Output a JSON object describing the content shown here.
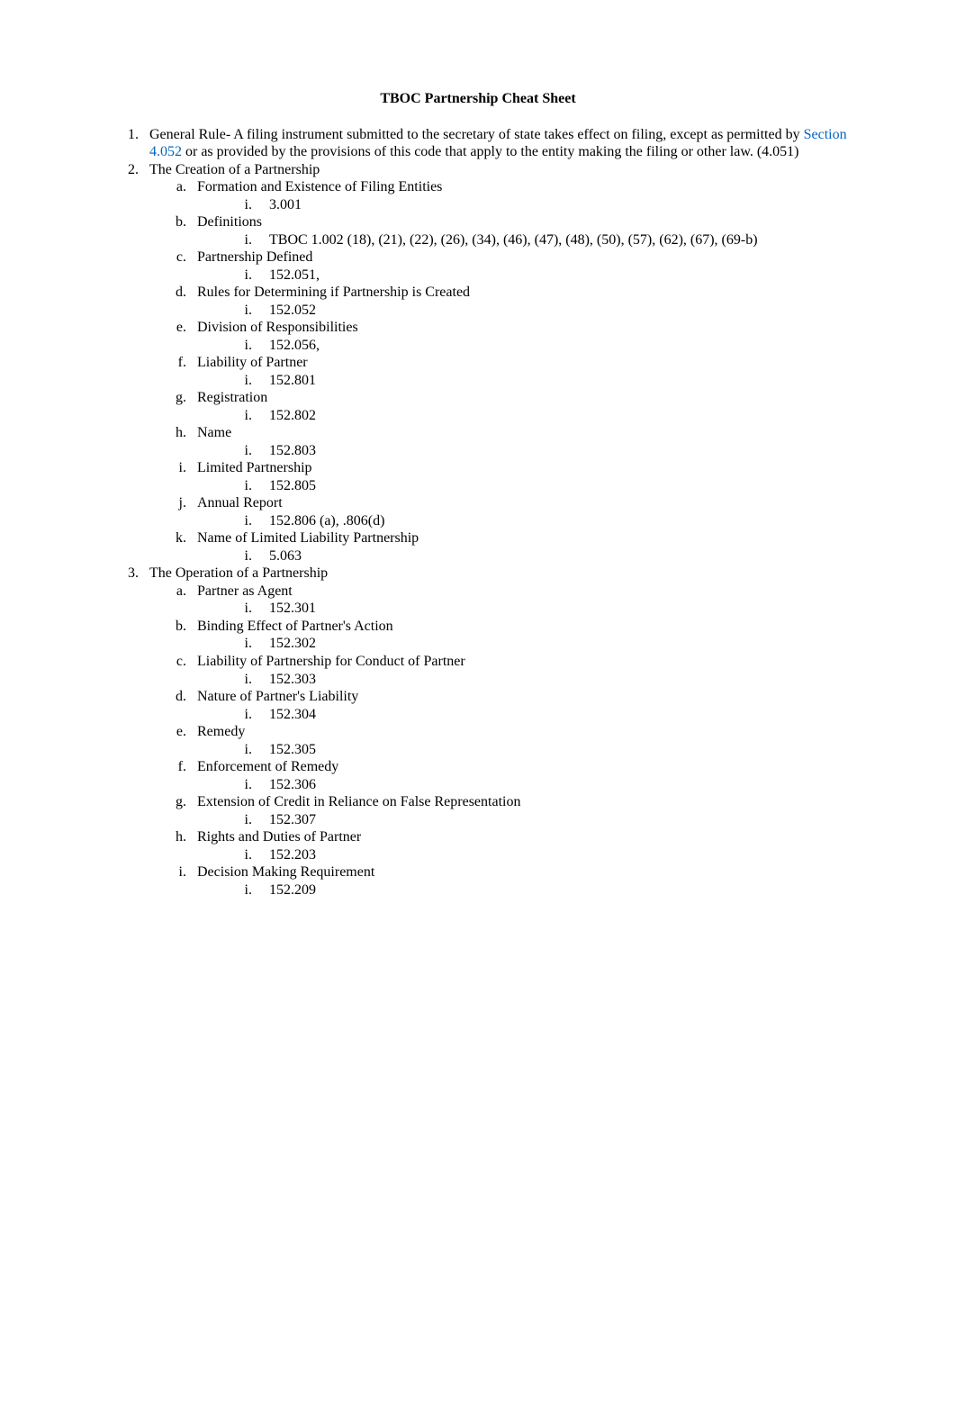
{
  "title": "TBOC Partnership Cheat Sheet",
  "items": {
    "1": {
      "pre": "General Rule- A filing instrument submitted to the secretary of state takes effect on filing, except as permitted by ",
      "link": "Section 4.052",
      "post": " or as provided by the provisions of this code that apply to the entity making the filing or other law. (4.051)"
    },
    "2": {
      "label": "The Creation of a Partnership",
      "a": {
        "label": "Formation and Existence of Filing Entities",
        "i": "3.001"
      },
      "b": {
        "label": "Definitions",
        "i": "TBOC 1.002 (18), (21), (22), (26), (34), (46), (47), (48), (50), (57), (62), (67), (69-b)"
      },
      "c": {
        "label": "Partnership Defined",
        "i": "152.051,"
      },
      "d": {
        "label": "Rules for Determining if Partnership is Created",
        "i": "152.052"
      },
      "e": {
        "label": "Division of Responsibilities",
        "i": "152.056,"
      },
      "f": {
        "label": "Liability of Partner",
        "i": "152.801"
      },
      "g": {
        "label": "Registration",
        "i": "152.802"
      },
      "h": {
        "label": "Name",
        "i": "152.803"
      },
      "i2": {
        "label": "Limited Partnership",
        "i": "152.805"
      },
      "j": {
        "label": "Annual Report",
        "i": "152.806 (a), .806(d)"
      },
      "k": {
        "label": "Name of Limited Liability Partnership",
        "i": "5.063"
      }
    },
    "3": {
      "label": "The Operation of a Partnership",
      "a": {
        "label": "Partner as Agent",
        "i": "152.301"
      },
      "b": {
        "label": "Binding Effect of Partner's Action",
        "i": "152.302"
      },
      "c": {
        "label": "Liability of Partnership for Conduct of Partner",
        "i": "152.303"
      },
      "d": {
        "label": "Nature of Partner's Liability",
        "i": "152.304"
      },
      "e": {
        "label": "Remedy",
        "i": "152.305"
      },
      "f": {
        "label": "Enforcement of Remedy",
        "i": "152.306"
      },
      "g": {
        "label": "Extension of Credit in Reliance on False Representation",
        "i": "152.307"
      },
      "h": {
        "label": "Rights and Duties of Partner",
        "i": "152.203"
      },
      "i2": {
        "label": "Decision Making Requirement",
        "i": "152.209"
      }
    }
  }
}
